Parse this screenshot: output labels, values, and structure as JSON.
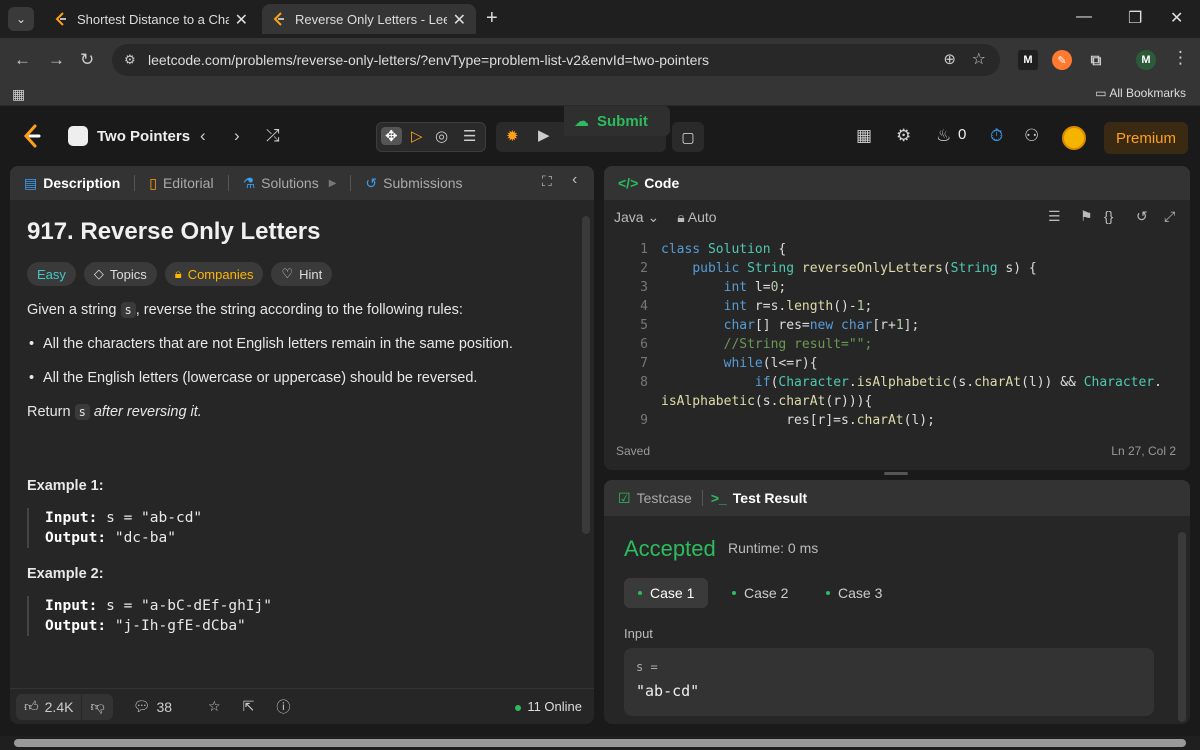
{
  "browser": {
    "tabs": [
      {
        "title": "Shortest Distance to a Characte",
        "active": false
      },
      {
        "title": "Reverse Only Letters - LeetCode",
        "active": true
      }
    ],
    "url": "leetcode.com/problems/reverse-only-letters/?envType=problem-list-v2&envId=two-pointers",
    "extensions": [
      "M",
      "M"
    ],
    "all_bookmarks": "All Bookmarks"
  },
  "header": {
    "list_name": "Two Pointers",
    "submit_label": "Submit",
    "streak": "0",
    "premium_label": "Premium"
  },
  "description": {
    "tabs": [
      "Description",
      "Editorial",
      "Solutions",
      "Submissions"
    ],
    "title": "917. Reverse Only Letters",
    "badges": [
      "Easy",
      "Topics",
      "Companies",
      "Hint"
    ],
    "intro_before": "Given a string ",
    "intro_code": "s",
    "intro_after": ", reverse the string according to the following rules:",
    "rules": [
      "All the characters that are not English letters remain in the same position.",
      "All the English letters (lowercase or uppercase) should be reversed."
    ],
    "return_before": "Return ",
    "return_code": "s",
    "return_after": " after reversing it.",
    "examples": [
      {
        "title": "Example 1:",
        "input_label": "Input:",
        "input": "s = \"ab-cd\"",
        "output_label": "Output:",
        "output": "\"dc-ba\""
      },
      {
        "title": "Example 2:",
        "input_label": "Input:",
        "input": "s = \"a-bC-dEf-ghIj\"",
        "output_label": "Output:",
        "output": "\"j-Ih-gfE-dCba\""
      }
    ],
    "footer": {
      "likes": "2.4K",
      "comments": "38",
      "online": "11 Online"
    }
  },
  "code": {
    "tab": "Code",
    "language": "Java",
    "auto": "Auto",
    "status": "Saved",
    "cursor": "Ln 27, Col 2",
    "line_numbers": [
      "1",
      "2",
      "3",
      "4",
      "5",
      "6",
      "7",
      "8",
      "",
      "9"
    ]
  },
  "result": {
    "tabs": [
      "Testcase",
      "Test Result"
    ],
    "status": "Accepted",
    "runtime": "Runtime: 0 ms",
    "cases": [
      "Case 1",
      "Case 2",
      "Case 3"
    ],
    "input_label": "Input",
    "var_name": "s =",
    "var_value": "\"ab-cd\""
  },
  "colors": {
    "accepted": "#2cbb5d",
    "premium": "#ffa116",
    "easy": "#46c6c2"
  }
}
